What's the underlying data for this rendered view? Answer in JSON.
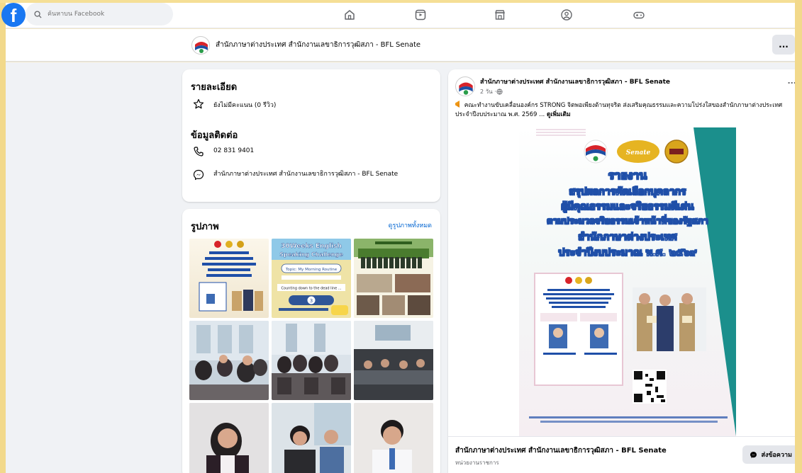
{
  "search": {
    "placeholder": "ค้นหาบน Facebook"
  },
  "nav": {
    "icons": [
      "home-icon",
      "video-icon",
      "marketplace-icon",
      "groups-icon",
      "gaming-icon"
    ]
  },
  "page": {
    "name": "สำนักภาษาต่างประเทศ สำนักงานเลขาธิการวุฒิสภา - BFL Senate",
    "more": "..."
  },
  "details": {
    "title": "รายละเอียด",
    "rating": "ยังไม่มีคะแนน (0 รีวิว)",
    "contact_title": "ข้อมูลติดต่อ",
    "phone": "02 831 9401",
    "messenger": "สำนักภาษาต่างประเทศ สำนักงานเลขาธิการวุฒิสภา - BFL Senate"
  },
  "photos": {
    "title": "รูปภาพ",
    "see_all": "ดูรูปภาพทั้งหมด",
    "thumb1_title": "30Weeks English Speaking Challenge",
    "thumb1_lines": [
      "Topic: My Morning Routine",
      "Counting down to the dead line ..."
    ]
  },
  "post": {
    "author": "สำนักภาษาต่างประเทศ สำนักงานเลขาธิการวุฒิสภา - BFL Senate",
    "time": "2 วัน · ",
    "more": "...",
    "text": "คณะทำงานขับเคลื่อนองค์กร STRONG จิตพอเพียงต้านทุจริต ส่งเสริมคุณธรรมและความโปร่งใสของสำนักภาษาต่างประเทศ ประจำปีงบประมาณ พ.ศ. 2569 ... ",
    "see_more": "ดูเพิ่มเติม",
    "poster": {
      "badge": "Senate STRONG",
      "lines": [
        "รายงาน",
        "สรุปผลการคัดเลือกบุคลากร",
        "ผู้มีคุณธรรมและจริยธรรมดีเด่น",
        "ตามประมวลจริยธรรมเจ้าหน้าที่ของรัฐสภา",
        "สำนักภาษาต่างประเทศ",
        "ประจำปีงบประมาณ พ.ศ. ๒๕๖๙"
      ]
    },
    "footer_name": "สำนักภาษาต่างประเทศ สำนักงานเลขาธิการวุฒิสภา - BFL Senate",
    "footer_type": "หน่วยงานราชการ",
    "message_btn": "ส่งข้อความ"
  },
  "colors": {
    "fb_blue": "#1877f2",
    "link": "#0064d1",
    "bg": "#f0f2f5",
    "teal": "#1b8f8c",
    "frame": "#f2d98b"
  }
}
